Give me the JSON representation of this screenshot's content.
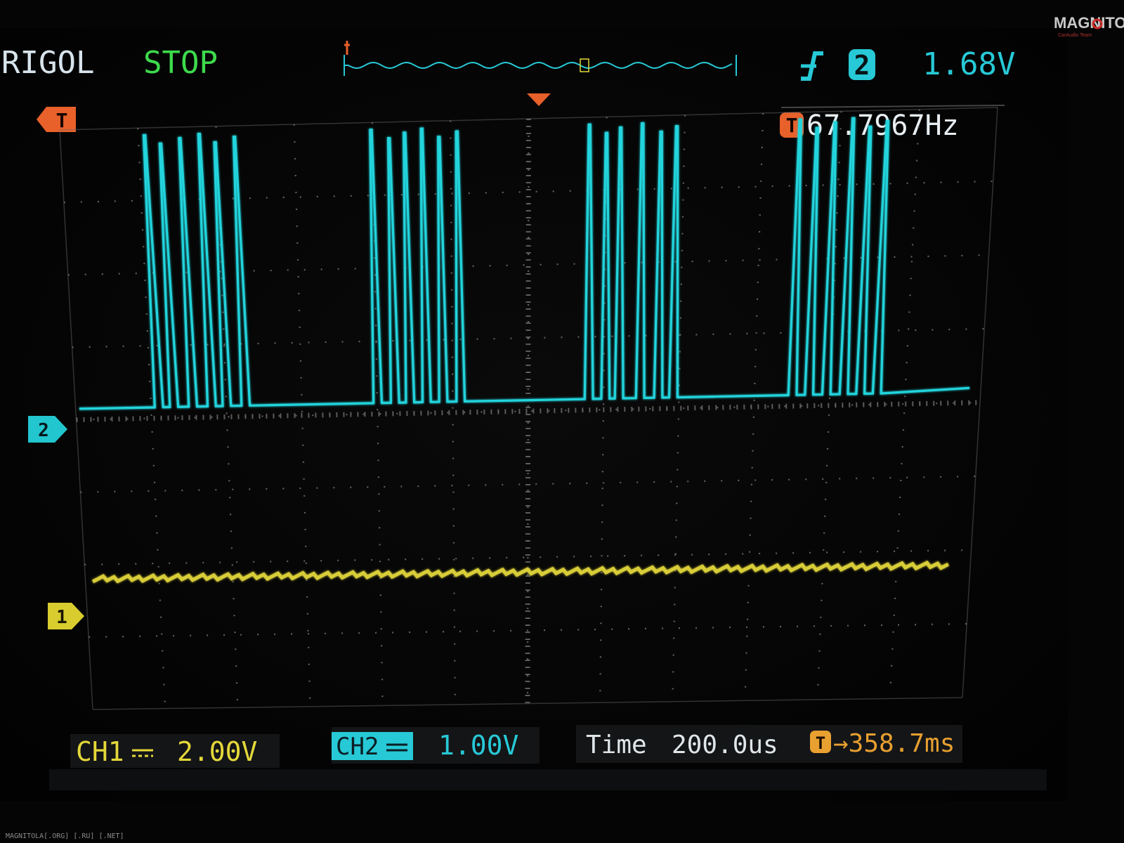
{
  "watermark": {
    "logo_text": "MAGNITOLA",
    "logo_sub": "CarAudio Team",
    "footer": "MAGNITOLA[.ORG] [.RU] [.NET]"
  },
  "header": {
    "brand": "RIGOL",
    "run_state": "STOP",
    "trigger_slope_icon": "rising-edge-icon",
    "trigger_source": "2",
    "trigger_level": "1.68V"
  },
  "markers": {
    "trigger_marker": "T",
    "ch2_marker": "2",
    "ch1_marker": "1"
  },
  "measurement": {
    "badge": "T",
    "frequency": "67.7967Hz"
  },
  "footer_bar": {
    "ch1_label": "CH1",
    "ch1_coupling_icon": "dc-coupling-icon",
    "ch1_scale": "2.00V",
    "ch2_label": "CH2",
    "ch2_scale": "1.00V",
    "time_label": "Time",
    "time_scale": "200.0us",
    "trigger_offset_badge": "T",
    "trigger_offset": "→358.7ms"
  },
  "colors": {
    "background": "#060606",
    "grid": "#6a6a6a",
    "ch1": "#e4d83a",
    "ch2": "#22d4dc",
    "state_green": "#3ddb4c",
    "trigger_orange": "#e8602a",
    "measure_orange": "#e8a030",
    "header_cyan": "#27c9d6",
    "brand_text": "#d8e4ec"
  },
  "chart_data": {
    "type": "line",
    "grid": true,
    "divisions": {
      "x": 12,
      "y": 8
    },
    "xlim": [
      0,
      12
    ],
    "ylim": [
      -4,
      4
    ],
    "series": [
      {
        "name": "CH2",
        "baseline_div": 0.15,
        "high_div": 3.9,
        "bursts": [
          [
            1.05,
            1.25,
            1.5,
            1.75,
            1.95,
            2.2
          ],
          [
            3.95,
            4.18,
            4.38,
            4.6,
            4.82,
            5.05
          ],
          [
            6.75,
            6.97,
            7.15,
            7.43,
            7.67,
            7.87
          ],
          [
            9.45,
            9.67,
            9.9,
            10.13,
            10.35,
            10.57
          ]
        ]
      },
      {
        "name": "CH1",
        "baseline_div": -2.2
      }
    ]
  }
}
